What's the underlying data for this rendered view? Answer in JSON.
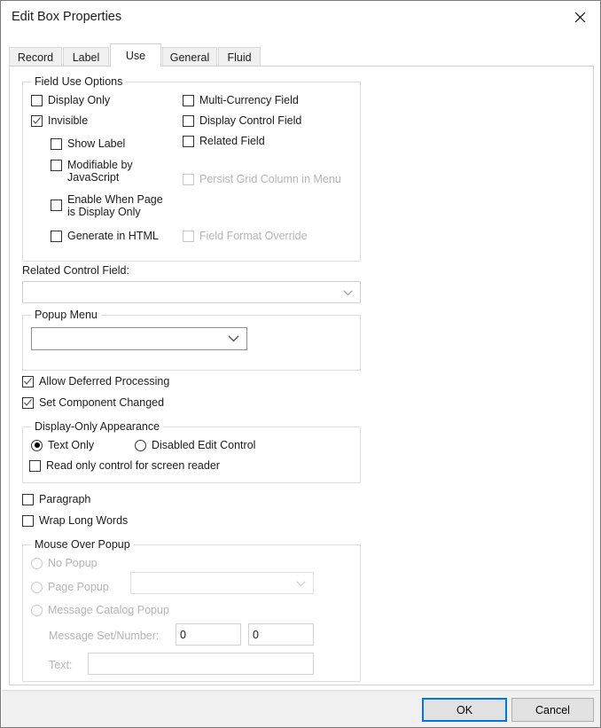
{
  "window": {
    "title": "Edit Box Properties",
    "close_icon": "close-icon"
  },
  "tabs": [
    {
      "label": "Record",
      "active": false
    },
    {
      "label": "Label",
      "active": false
    },
    {
      "label": "Use",
      "active": true
    },
    {
      "label": "General",
      "active": false
    },
    {
      "label": "Fluid",
      "active": false
    }
  ],
  "field_use_options": {
    "title": "Field Use Options",
    "left_column": [
      {
        "label": "Display Only",
        "checked": false,
        "enabled": true
      },
      {
        "label": "Invisible",
        "checked": true,
        "enabled": true
      },
      {
        "label": "Show Label",
        "checked": false,
        "enabled": true
      },
      {
        "label": "Modifiable by JavaScript",
        "checked": false,
        "enabled": true
      },
      {
        "label": "Enable When Page is Display Only",
        "checked": false,
        "enabled": true
      },
      {
        "label": "Generate in HTML",
        "checked": false,
        "enabled": true
      }
    ],
    "right_column": [
      {
        "label": "Multi-Currency Field",
        "checked": false,
        "enabled": true
      },
      {
        "label": "Display Control Field",
        "checked": false,
        "enabled": true
      },
      {
        "label": "Related Field",
        "checked": false,
        "enabled": true
      },
      {
        "label": "Persist Grid Column in Menu",
        "checked": false,
        "enabled": false
      },
      {
        "label": "Field Format Override",
        "checked": false,
        "enabled": false
      }
    ]
  },
  "related_control_field": {
    "label": "Related Control Field:",
    "value": "",
    "chevron_icon": "chevron-down-icon"
  },
  "popup_menu": {
    "title": "Popup Menu",
    "value": "",
    "chevron_icon": "chevron-down-icon"
  },
  "standalone_options": [
    {
      "label": "Allow Deferred Processing",
      "checked": true
    },
    {
      "label": "Set Component Changed",
      "checked": true
    }
  ],
  "display_only_appearance": {
    "title": "Display-Only Appearance",
    "radios": [
      {
        "label": "Text Only",
        "selected": true
      },
      {
        "label": "Disabled Edit Control",
        "selected": false
      }
    ],
    "checkbox": {
      "label": "Read only control for screen reader",
      "checked": false
    }
  },
  "text_options": [
    {
      "label": "Paragraph",
      "checked": false
    },
    {
      "label": "Wrap Long Words",
      "checked": false
    }
  ],
  "mouse_over_popup": {
    "title": "Mouse Over Popup",
    "enabled": false,
    "radios": [
      {
        "label": "No Popup",
        "selected": false
      },
      {
        "label": "Page Popup",
        "selected": false
      },
      {
        "label": "Message Catalog Popup",
        "selected": false
      }
    ],
    "page_popup_value": "",
    "chevron_icon": "chevron-down-icon",
    "message_set_label": "Message Set/Number:",
    "message_set_value": "0",
    "message_number_value": "0",
    "text_label": "Text:",
    "text_value": ""
  },
  "footer": {
    "ok_label": "OK",
    "cancel_label": "Cancel"
  },
  "colors": {
    "accent": "#0078d7",
    "panel": "#ffffff",
    "chrome": "#f0f0f0",
    "disabled_text": "#b4b4b4"
  }
}
